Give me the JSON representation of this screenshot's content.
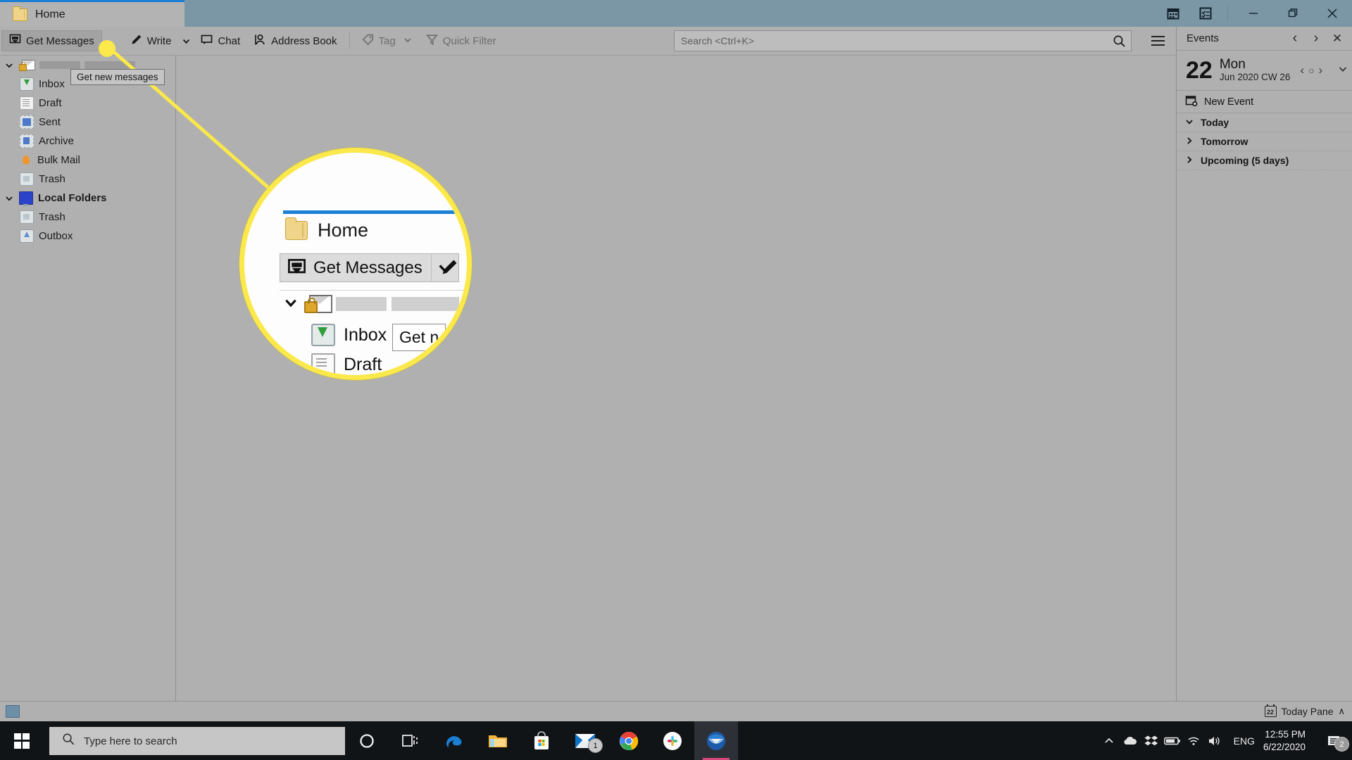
{
  "window": {
    "tab_label": "Home",
    "tab_icon": "folder-icon",
    "title_icons": [
      "calendar-icon",
      "tasks-icon"
    ],
    "controls": {
      "minimize": "—",
      "maximize": "❐",
      "close": "✕"
    }
  },
  "toolbar": {
    "get_messages": "Get Messages",
    "write": "Write",
    "chat": "Chat",
    "address_book": "Address Book",
    "tag": "Tag",
    "quick_filter": "Quick Filter",
    "search_placeholder": "Search <Ctrl+K>",
    "search_value": "",
    "menu_icon": "hamburger-icon"
  },
  "tooltip": {
    "text": "Get new messages"
  },
  "folder_pane": {
    "account": {
      "label": "",
      "redacted": true,
      "icon": "secure-mail-account-icon"
    },
    "account_folders": [
      {
        "label": "Inbox",
        "icon": "inbox-icon"
      },
      {
        "label": "Draft",
        "icon": "draft-icon"
      },
      {
        "label": "Sent",
        "icon": "sent-icon"
      },
      {
        "label": "Archive",
        "icon": "archive-icon"
      },
      {
        "label": "Bulk Mail",
        "icon": "bulk-mail-icon"
      },
      {
        "label": "Trash",
        "icon": "trash-icon"
      }
    ],
    "local_folders": {
      "label": "Local Folders",
      "icon": "local-folders-icon"
    },
    "local_folder_items": [
      {
        "label": "Trash",
        "icon": "trash-icon"
      },
      {
        "label": "Outbox",
        "icon": "outbox-icon"
      }
    ]
  },
  "events_pane": {
    "title": "Events",
    "prev": "‹",
    "next": "›",
    "close": "✕",
    "day_number": "22",
    "day_name": "Mon",
    "day_sub": "Jun 2020  CW 26",
    "date_prev": "‹",
    "date_today": "○",
    "date_next": "›",
    "expand": "⌄",
    "new_event": "New Event",
    "new_event_icon": "new-event-calendar-icon",
    "sections": [
      {
        "label": "Today",
        "expanded": true
      },
      {
        "label": "Tomorrow",
        "expanded": false
      },
      {
        "label": "Upcoming (5 days)",
        "expanded": false
      }
    ]
  },
  "statusbar": {
    "today_pane": "Today Pane",
    "today_pane_day": "22",
    "chevron": "∧",
    "status_icon": "connection-icon"
  },
  "magnifier": {
    "tab_label": "Home",
    "get_messages": "Get Messages",
    "dropdown": "⌄",
    "write_icon": "pencil-icon",
    "account_redacted": true,
    "inbox": "Inbox",
    "draft": "Draft",
    "tooltip": "Get n",
    "highlight_color": "#fbe84a",
    "accent_color": "#1b7fd4"
  },
  "taskbar": {
    "start": "start-button",
    "search_placeholder": "Type here to search",
    "apps": [
      {
        "name": "cortana-icon",
        "badge": null
      },
      {
        "name": "task-view-icon",
        "badge": null
      },
      {
        "name": "edge-icon",
        "badge": null
      },
      {
        "name": "file-explorer-icon",
        "badge": null
      },
      {
        "name": "microsoft-store-icon",
        "badge": null
      },
      {
        "name": "mail-icon",
        "badge": "1"
      },
      {
        "name": "chrome-icon",
        "badge": null
      },
      {
        "name": "slack-icon",
        "badge": null
      },
      {
        "name": "thunderbird-icon",
        "badge": null
      }
    ],
    "tray": {
      "show_hidden": "∧",
      "icons": [
        "onedrive-icon",
        "dropbox-icon",
        "battery-icon",
        "wifi-icon",
        "volume-icon"
      ],
      "language": "ENG",
      "time": "12:55 PM",
      "date": "6/22/2020",
      "notifications_badge": "2"
    }
  }
}
